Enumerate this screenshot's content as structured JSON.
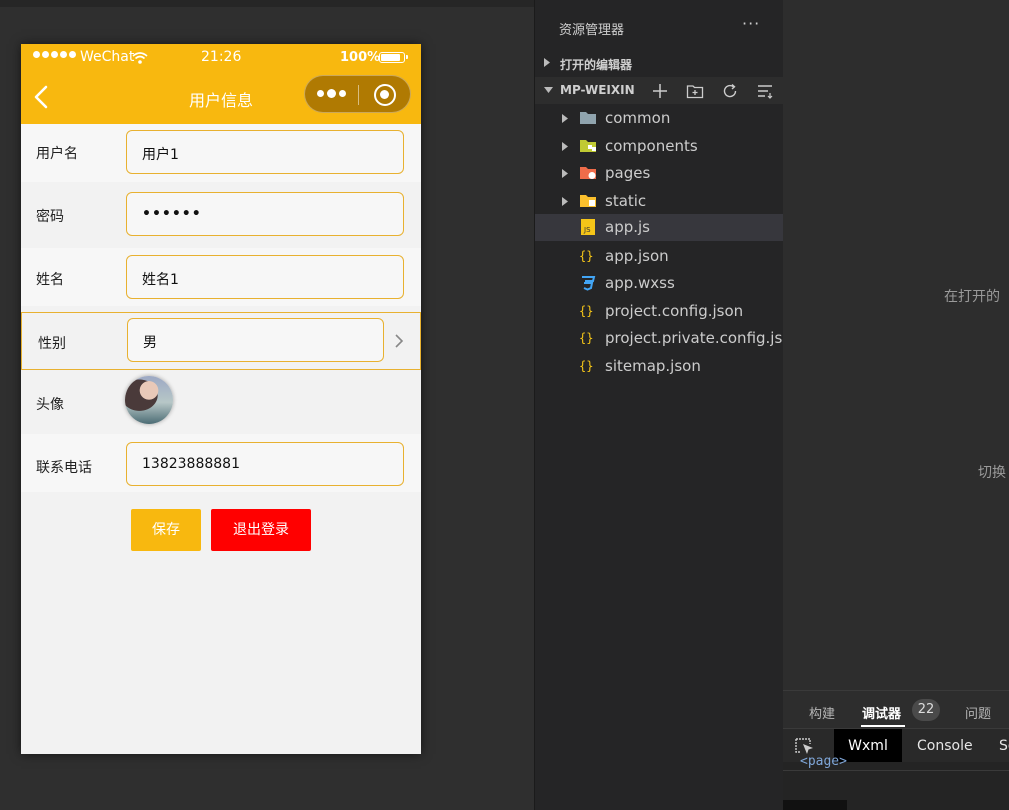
{
  "phone": {
    "status_bar": {
      "carrier": "WeChat",
      "time": "21:26",
      "battery_pct": "100%"
    },
    "nav": {
      "title": "用户信息"
    },
    "form": {
      "username": {
        "label": "用户名",
        "value": "用户1"
      },
      "password": {
        "label": "密码",
        "value": "••••••"
      },
      "name": {
        "label": "姓名",
        "value": "姓名1"
      },
      "gender": {
        "label": "性别",
        "value": "男"
      },
      "avatar": {
        "label": "头像"
      },
      "phone": {
        "label": "联系电话",
        "value": "13823888881"
      }
    },
    "buttons": {
      "save": "保存",
      "logout": "退出登录"
    },
    "colors": {
      "brand": "#f8b80f",
      "danger": "#ff0000"
    }
  },
  "explorer": {
    "title": "资源管理器",
    "more": "···",
    "open_editors": "打开的编辑器",
    "project": "MP-WEIXIN",
    "items": [
      {
        "name": "common",
        "type": "folder",
        "icon": "folder-icon"
      },
      {
        "name": "components",
        "type": "folder",
        "icon": "components-folder-icon"
      },
      {
        "name": "pages",
        "type": "folder",
        "icon": "pages-folder-icon"
      },
      {
        "name": "static",
        "type": "folder",
        "icon": "static-folder-icon"
      },
      {
        "name": "app.js",
        "type": "file",
        "icon": "js-file-icon",
        "selected": true
      },
      {
        "name": "app.json",
        "type": "file",
        "icon": "json-file-icon"
      },
      {
        "name": "app.wxss",
        "type": "file",
        "icon": "css-file-icon"
      },
      {
        "name": "project.config.json",
        "type": "file",
        "icon": "json-file-icon"
      },
      {
        "name": "project.private.config.js...",
        "type": "file",
        "icon": "json-file-icon"
      },
      {
        "name": "sitemap.json",
        "type": "file",
        "icon": "json-file-icon"
      }
    ]
  },
  "right_panel": {
    "hint_1": "在打开的",
    "hint_2": "切换",
    "debug_tabs": {
      "build": "构建",
      "debugger": "调试器",
      "debugger_badge": "22",
      "problems": "问题"
    },
    "devtools_tabs": {
      "wxml": "Wxml",
      "console": "Console",
      "sources": "So"
    },
    "xml_preview": "<page>"
  }
}
